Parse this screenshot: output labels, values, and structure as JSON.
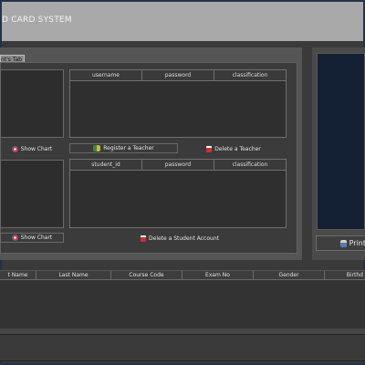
{
  "window": {
    "title": "D CARD SYSTEM"
  },
  "tab": {
    "label": "nt's Tab"
  },
  "teacher_table": {
    "columns": [
      "username",
      "password",
      "classification"
    ]
  },
  "student_table": {
    "columns": [
      "student_id",
      "password",
      "classification"
    ]
  },
  "buttons": {
    "show_chart_1": "Show Chart",
    "register_teacher": "Register a Teacher",
    "delete_teacher": "Delete a Teacher",
    "show_chart_2": "Show Chart",
    "delete_student": "Delete a Student Account",
    "print": "Print"
  },
  "bottom_table": {
    "columns": [
      "t Name",
      "Last Name",
      "Course Code",
      "Exam No",
      "Gender",
      "Birthd"
    ]
  },
  "colors": {
    "accent": "#142033",
    "titlebar": "#a9a9a9"
  },
  "icons": {
    "chart": "chart-icon",
    "register": "add-user-icon",
    "delete": "delete-icon",
    "print": "printer-icon"
  }
}
